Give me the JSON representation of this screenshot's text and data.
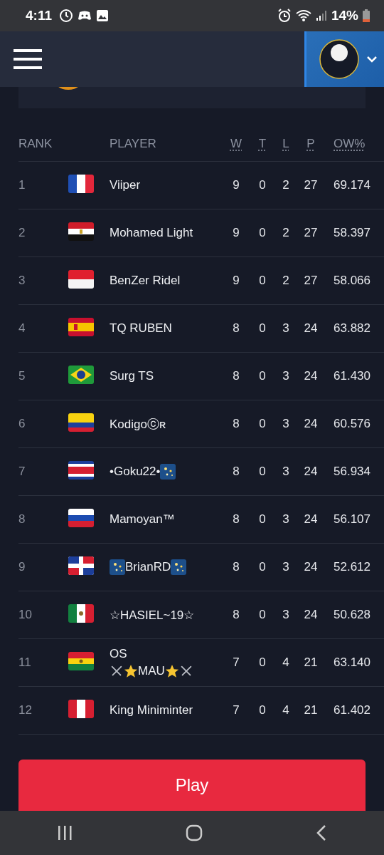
{
  "status_bar": {
    "time": "4:11",
    "battery": "14%"
  },
  "table": {
    "columns": [
      {
        "label": "RANK",
        "underlined": false
      },
      {
        "label": "PLAYER",
        "underlined": false
      },
      {
        "label": "W",
        "underlined": true
      },
      {
        "label": "T",
        "underlined": true
      },
      {
        "label": "L",
        "underlined": true
      },
      {
        "label": "P",
        "underlined": true
      },
      {
        "label": "OW%",
        "underlined": true
      }
    ],
    "rows": [
      {
        "rank": "1",
        "flag": {
          "kind": "fr"
        },
        "name": [
          [
            {
              "kind": "text",
              "text": "Viiper"
            }
          ]
        ],
        "w": "9",
        "t": "0",
        "l": "2",
        "p": "27",
        "ow": "69.174"
      },
      {
        "rank": "2",
        "flag": {
          "kind": "eg"
        },
        "name": [
          [
            {
              "kind": "text",
              "text": "Mohamed Light"
            }
          ]
        ],
        "w": "9",
        "t": "0",
        "l": "2",
        "p": "27",
        "ow": "58.397"
      },
      {
        "rank": "3",
        "flag": {
          "kind": "id"
        },
        "name": [
          [
            {
              "kind": "text",
              "text": "BenZer Ridel"
            }
          ]
        ],
        "w": "9",
        "t": "0",
        "l": "2",
        "p": "27",
        "ow": "58.066"
      },
      {
        "rank": "4",
        "flag": {
          "kind": "es"
        },
        "name": [
          [
            {
              "kind": "text",
              "text": "TQ RUBEN"
            }
          ]
        ],
        "w": "8",
        "t": "0",
        "l": "3",
        "p": "24",
        "ow": "63.882"
      },
      {
        "rank": "5",
        "flag": {
          "kind": "br"
        },
        "name": [
          [
            {
              "kind": "text",
              "text": "Surg TS"
            }
          ]
        ],
        "w": "8",
        "t": "0",
        "l": "3",
        "p": "24",
        "ow": "61.430"
      },
      {
        "rank": "6",
        "flag": {
          "kind": "co"
        },
        "name": [
          [
            {
              "kind": "text",
              "text": "Kodigoⓒʀ"
            }
          ]
        ],
        "w": "8",
        "t": "0",
        "l": "3",
        "p": "24",
        "ow": "60.576"
      },
      {
        "rank": "7",
        "flag": {
          "kind": "cr"
        },
        "name": [
          [
            {
              "kind": "text",
              "text": "•Goku22•"
            },
            {
              "kind": "fireworks"
            }
          ]
        ],
        "w": "8",
        "t": "0",
        "l": "3",
        "p": "24",
        "ow": "56.934"
      },
      {
        "rank": "8",
        "flag": {
          "kind": "ru"
        },
        "name": [
          [
            {
              "kind": "text",
              "text": "Mamoyan™"
            }
          ]
        ],
        "w": "8",
        "t": "0",
        "l": "3",
        "p": "24",
        "ow": "56.107"
      },
      {
        "rank": "9",
        "flag": {
          "kind": "do"
        },
        "name": [
          [
            {
              "kind": "fireworks"
            },
            {
              "kind": "text",
              "text": "BrianRD"
            },
            {
              "kind": "fireworks"
            }
          ]
        ],
        "w": "8",
        "t": "0",
        "l": "3",
        "p": "24",
        "ow": "52.612"
      },
      {
        "rank": "10",
        "flag": {
          "kind": "mx"
        },
        "name": [
          [
            {
              "kind": "text",
              "text": "☆HASIEL~19☆"
            }
          ]
        ],
        "w": "8",
        "t": "0",
        "l": "3",
        "p": "24",
        "ow": "50.628"
      },
      {
        "rank": "11",
        "flag": {
          "kind": "bo"
        },
        "name": [
          [
            {
              "kind": "text",
              "text": "OS"
            }
          ],
          [
            {
              "kind": "swords"
            },
            {
              "kind": "star"
            },
            {
              "kind": "text",
              "text": "MAU"
            },
            {
              "kind": "star"
            },
            {
              "kind": "swords"
            }
          ]
        ],
        "w": "7",
        "t": "0",
        "l": "4",
        "p": "21",
        "ow": "63.140"
      },
      {
        "rank": "12",
        "flag": {
          "kind": "pe"
        },
        "name": [
          [
            {
              "kind": "text",
              "text": "King Miniminter"
            }
          ]
        ],
        "w": "7",
        "t": "0",
        "l": "4",
        "p": "21",
        "ow": "61.402"
      }
    ]
  },
  "play_button": {
    "label": "Play"
  }
}
